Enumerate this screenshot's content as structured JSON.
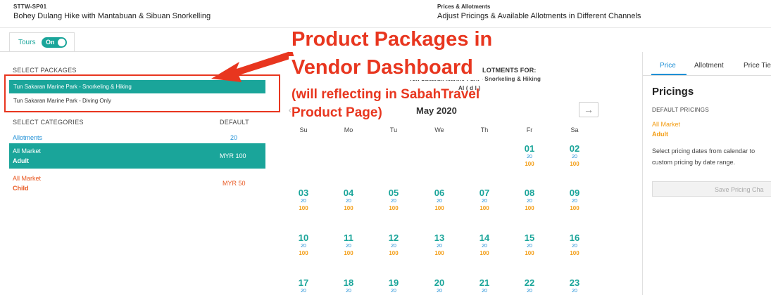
{
  "header": {
    "product_code": "STTW-SP01",
    "product_name": "Bohey Dulang Hike with Mantabuan & Sibuan Snorkelling",
    "section_title": "Prices & Allotments",
    "section_subtitle": "Adjust Pricings & Available Allotments in Different Channels"
  },
  "tours_toggle": {
    "label": "Tours",
    "state_label": "On",
    "on": true
  },
  "packages": {
    "title": "SELECT PACKAGES",
    "items": [
      {
        "label": "Tun Sakaran Marine Park - Snorkeling & Hiking",
        "selected": true
      },
      {
        "label": "Tun Sakaran Marine Park - Diving Only",
        "selected": false
      }
    ]
  },
  "categories": {
    "title": "SELECT CATEGORIES",
    "default_header": "DEFAULT",
    "allotments_label": "Allotments",
    "allotments_value": "20",
    "items": [
      {
        "market": "All Market",
        "type": "Adult",
        "price": "MYR 100",
        "selected": true
      },
      {
        "market": "All Market",
        "type": "Child",
        "price": "MYR 50",
        "selected": false
      }
    ]
  },
  "calendar": {
    "heading": "LOTMENTS FOR:",
    "package": "Tun Sakaran Marine Park - Snorkeling & Hiking",
    "partial_line": "Al  (  d  l  )",
    "month": "May 2020",
    "next_icon": "arrow-right-icon",
    "weekdays": [
      "Su",
      "Mo",
      "Tu",
      "We",
      "Th",
      "Fr",
      "Sa"
    ],
    "days": [
      {
        "day": "01",
        "allot": "20",
        "price": "100",
        "col": 5,
        "row": 0
      },
      {
        "day": "02",
        "allot": "20",
        "price": "100",
        "col": 6,
        "row": 0
      },
      {
        "day": "03",
        "allot": "20",
        "price": "100",
        "col": 0,
        "row": 1
      },
      {
        "day": "04",
        "allot": "20",
        "price": "100",
        "col": 1,
        "row": 1
      },
      {
        "day": "05",
        "allot": "20",
        "price": "100",
        "col": 2,
        "row": 1
      },
      {
        "day": "06",
        "allot": "20",
        "price": "100",
        "col": 3,
        "row": 1
      },
      {
        "day": "07",
        "allot": "20",
        "price": "100",
        "col": 4,
        "row": 1
      },
      {
        "day": "08",
        "allot": "20",
        "price": "100",
        "col": 5,
        "row": 1
      },
      {
        "day": "09",
        "allot": "20",
        "price": "100",
        "col": 6,
        "row": 1
      },
      {
        "day": "10",
        "allot": "20",
        "price": "100",
        "col": 0,
        "row": 2
      },
      {
        "day": "11",
        "allot": "20",
        "price": "100",
        "col": 1,
        "row": 2
      },
      {
        "day": "12",
        "allot": "20",
        "price": "100",
        "col": 2,
        "row": 2
      },
      {
        "day": "13",
        "allot": "20",
        "price": "100",
        "col": 3,
        "row": 2
      },
      {
        "day": "14",
        "allot": "20",
        "price": "100",
        "col": 4,
        "row": 2
      },
      {
        "day": "15",
        "allot": "20",
        "price": "100",
        "col": 5,
        "row": 2
      },
      {
        "day": "16",
        "allot": "20",
        "price": "100",
        "col": 6,
        "row": 2
      },
      {
        "day": "17",
        "allot": "20",
        "price": "",
        "col": 0,
        "row": 3
      },
      {
        "day": "18",
        "allot": "20",
        "price": "",
        "col": 1,
        "row": 3
      },
      {
        "day": "19",
        "allot": "20",
        "price": "",
        "col": 2,
        "row": 3
      },
      {
        "day": "20",
        "allot": "20",
        "price": "",
        "col": 3,
        "row": 3
      },
      {
        "day": "21",
        "allot": "20",
        "price": "",
        "col": 4,
        "row": 3
      },
      {
        "day": "22",
        "allot": "20",
        "price": "",
        "col": 5,
        "row": 3
      },
      {
        "day": "23",
        "allot": "20",
        "price": "",
        "col": 6,
        "row": 3
      }
    ]
  },
  "right_panel": {
    "tabs": [
      "Price",
      "Allotment",
      "Price Tie"
    ],
    "active_tab": "Price",
    "title": "Pricings",
    "default_pricings": "DEFAULT PRICINGS",
    "market": "All Market",
    "type": "Adult",
    "help_line1": "Select pricing dates from calendar to",
    "help_line2": "custom pricing by date range.",
    "save_button": "Save Pricing Cha"
  },
  "annotation": {
    "line1": "Product Packages in",
    "line2": "Vendor Dashboard",
    "line3": "(will reflecting in SabahTravel",
    "line4": "Product Page)",
    "color": "#e8361f"
  },
  "colors": {
    "accent": "#1aa59a",
    "link_blue": "#1e8fd6",
    "price_orange": "#f39c12",
    "child_red": "#e8561f"
  }
}
